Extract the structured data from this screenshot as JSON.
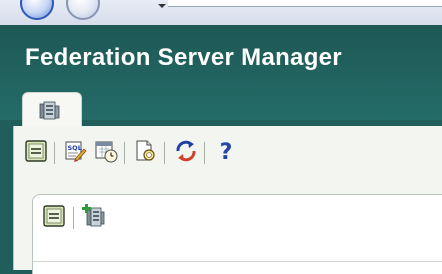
{
  "app": {
    "title": "Federation Server Manager"
  },
  "browser": {
    "icons": [
      "back-icon",
      "forward-icon",
      "dropdown-caret-icon"
    ]
  },
  "tabs": [
    {
      "icon": "server-icon",
      "label": ""
    }
  ],
  "toolbar": {
    "items": [
      {
        "name": "collapse-panel-button",
        "icon": "collapse-icon"
      },
      {
        "name": "sql-button",
        "icon": "sql-icon",
        "icon_text": "SQL"
      },
      {
        "name": "schedule-button",
        "icon": "calendar-clock-icon"
      },
      {
        "name": "view-log-button",
        "icon": "document-search-icon"
      },
      {
        "name": "refresh-button",
        "icon": "refresh-icon"
      },
      {
        "name": "help-button",
        "icon": "help-icon",
        "glyph": "?"
      }
    ]
  },
  "panel": {
    "items": [
      {
        "name": "panel-collapse-button",
        "icon": "collapse-icon"
      },
      {
        "name": "add-server-button",
        "icon": "add-server-icon"
      }
    ]
  },
  "colors": {
    "header": "#226663",
    "title_text": "#ffffff",
    "toolbar_bg": "#f3f5f1",
    "accent_blue": "#2446a8"
  }
}
